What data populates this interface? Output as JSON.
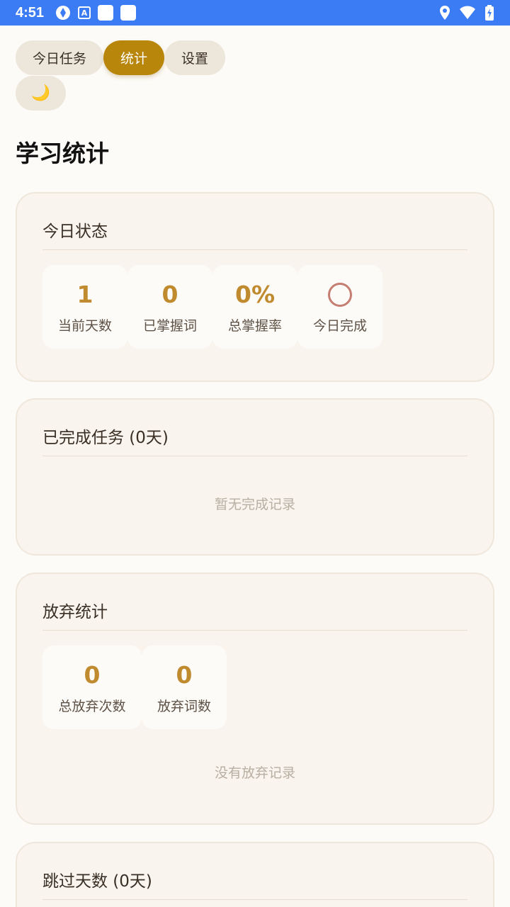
{
  "status_bar": {
    "time": "4:51"
  },
  "nav": {
    "tabs": [
      "今日任务",
      "统计",
      "设置"
    ],
    "theme_icon": "🌙"
  },
  "page_title": "学习统计",
  "today_status": {
    "title": "今日状态",
    "stats": [
      {
        "value": "1",
        "label": "当前天数"
      },
      {
        "value": "0",
        "label": "已掌握词"
      },
      {
        "value": "0%",
        "label": "总掌握率"
      },
      {
        "icon": "circle-incomplete-icon",
        "label": "今日完成"
      }
    ]
  },
  "completed_tasks": {
    "title": "已完成任务 (0天)",
    "empty_text": "暂无完成记录"
  },
  "abandon_stats": {
    "title": "放弃统计",
    "stats": [
      {
        "value": "0",
        "label": "总放弃次数"
      },
      {
        "value": "0",
        "label": "放弃词数"
      }
    ],
    "empty_text": "没有放弃记录"
  },
  "skipped_days": {
    "title": "跳过天数 (0天)"
  },
  "colors": {
    "accent": "#b8860b",
    "stat_value": "#c08a2e",
    "status_bar": "#3b7cf5"
  }
}
